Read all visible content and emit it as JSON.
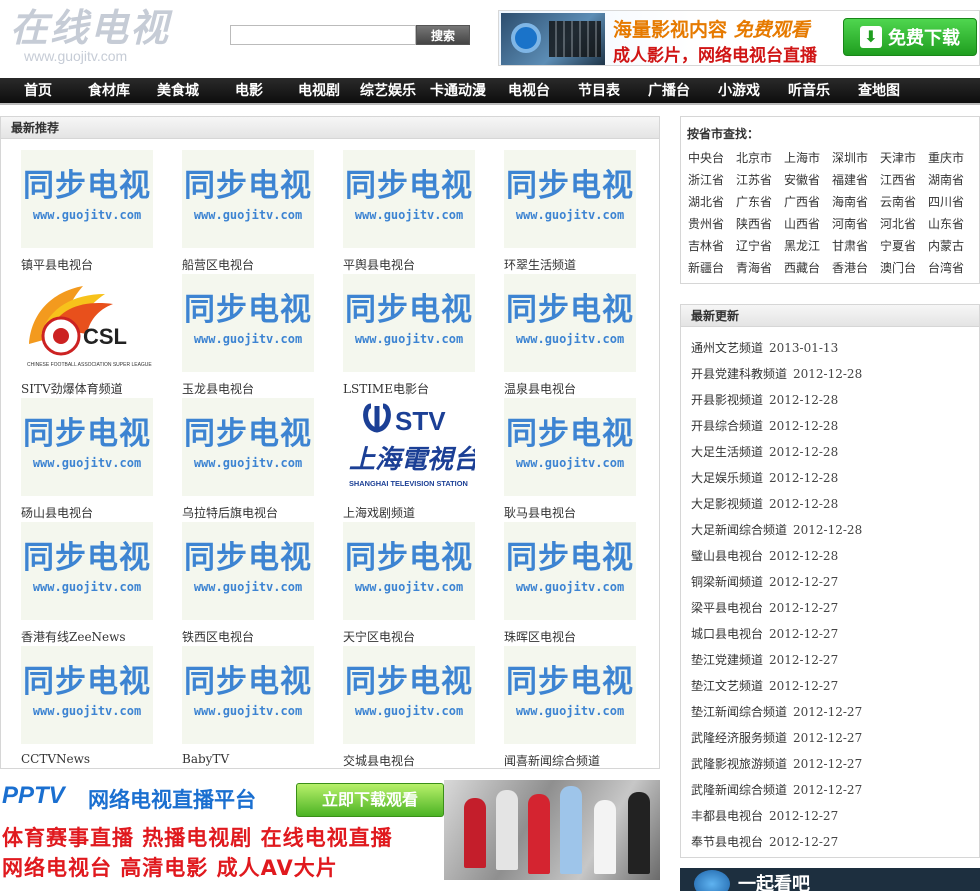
{
  "header": {
    "logo_text": "在线电视",
    "logo_url": "www.guojitv.com",
    "search_placeholder": "",
    "search_button": "搜索"
  },
  "ad_top": {
    "line1_a": "海量影视内容",
    "line1_b": "免费观看",
    "line2": "成人影片，网络电视台直播",
    "download": "免费下载"
  },
  "nav": [
    "首页",
    "食材库",
    "美食城",
    "电影",
    "电视剧",
    "综艺娱乐",
    "卡通动漫",
    "电视台",
    "节目表",
    "广播台",
    "小游戏",
    "听音乐",
    "查地图"
  ],
  "recommend": {
    "title": "最新推荐",
    "placeholder_big": "同步电视",
    "placeholder_small": "www.guojitv.com",
    "items": [
      {
        "name": "镇平县电视台",
        "thumb": "placeholder"
      },
      {
        "name": "船营区电视台",
        "thumb": "placeholder"
      },
      {
        "name": "平舆县电视台",
        "thumb": "placeholder"
      },
      {
        "name": "环翠生活频道",
        "thumb": "placeholder"
      },
      {
        "name": "SITV劲爆体育频道",
        "thumb": "csl"
      },
      {
        "name": "玉龙县电视台",
        "thumb": "placeholder"
      },
      {
        "name": "LSTIME电影台",
        "thumb": "placeholder"
      },
      {
        "name": "温泉县电视台",
        "thumb": "placeholder"
      },
      {
        "name": "砀山县电视台",
        "thumb": "placeholder"
      },
      {
        "name": "乌拉特后旗电视台",
        "thumb": "placeholder"
      },
      {
        "name": "上海戏剧频道",
        "thumb": "stv"
      },
      {
        "name": "耿马县电视台",
        "thumb": "placeholder"
      },
      {
        "name": "香港有线ZeeNews",
        "thumb": "placeholder"
      },
      {
        "name": "铁西区电视台",
        "thumb": "placeholder"
      },
      {
        "name": "天宁区电视台",
        "thumb": "placeholder"
      },
      {
        "name": "珠晖区电视台",
        "thumb": "placeholder"
      },
      {
        "name": "CCTVNews",
        "thumb": "placeholder"
      },
      {
        "name": "BabyTV",
        "thumb": "placeholder"
      },
      {
        "name": "交城县电视台",
        "thumb": "placeholder"
      },
      {
        "name": "闻喜新闻综合频道",
        "thumb": "placeholder"
      }
    ]
  },
  "csl": {
    "text": "CSL",
    "subtext": "CHINESE FOOTBALL ASSOCIATION SUPER LEAGUE"
  },
  "stv": {
    "brand": "STV",
    "cn": "上海電視台",
    "en": "SHANGHAI TELEVISION STATION"
  },
  "banner": {
    "brand": "PPTV",
    "slogan": "网络电视直播平台",
    "button": "立即下载观看",
    "row1": "体育赛事直播  热播电视剧  在线电视直播",
    "row2": "网络电视台  高清电影  成人AV大片"
  },
  "provinces": {
    "title": "按省市查找：",
    "items": [
      "中央台",
      "北京市",
      "上海市",
      "深圳市",
      "天津市",
      "重庆市",
      "浙江省",
      "江苏省",
      "安徽省",
      "福建省",
      "江西省",
      "湖南省",
      "湖北省",
      "广东省",
      "广西省",
      "海南省",
      "云南省",
      "四川省",
      "贵州省",
      "陕西省",
      "山西省",
      "河南省",
      "河北省",
      "山东省",
      "吉林省",
      "辽宁省",
      "黑龙江",
      "甘肃省",
      "宁夏省",
      "内蒙古",
      "新疆台",
      "青海省",
      "西藏台",
      "香港台",
      "澳门台",
      "台湾省"
    ]
  },
  "updates": {
    "title": "最新更新",
    "items": [
      {
        "name": "通州文艺频道",
        "date": "2013-01-13"
      },
      {
        "name": "开县党建科教频道",
        "date": "2012-12-28"
      },
      {
        "name": "开县影视频道",
        "date": "2012-12-28"
      },
      {
        "name": "开县综合频道",
        "date": "2012-12-28"
      },
      {
        "name": "大足生活频道",
        "date": "2012-12-28"
      },
      {
        "name": "大足娱乐频道",
        "date": "2012-12-28"
      },
      {
        "name": "大足影视频道",
        "date": "2012-12-28"
      },
      {
        "name": "大足新闻综合频道",
        "date": "2012-12-28"
      },
      {
        "name": "璧山县电视台",
        "date": "2012-12-28"
      },
      {
        "name": "铜梁新闻频道",
        "date": "2012-12-27"
      },
      {
        "name": "梁平县电视台",
        "date": "2012-12-27"
      },
      {
        "name": "城口县电视台",
        "date": "2012-12-27"
      },
      {
        "name": "垫江党建频道",
        "date": "2012-12-27"
      },
      {
        "name": "垫江文艺频道",
        "date": "2012-12-27"
      },
      {
        "name": "垫江新闻综合频道",
        "date": "2012-12-27"
      },
      {
        "name": "武隆经济服务频道",
        "date": "2012-12-27"
      },
      {
        "name": "武隆影视旅游频道",
        "date": "2012-12-27"
      },
      {
        "name": "武隆新闻综合频道",
        "date": "2012-12-27"
      },
      {
        "name": "丰都县电视台",
        "date": "2012-12-27"
      },
      {
        "name": "奉节县电视台",
        "date": "2012-12-27"
      }
    ]
  },
  "together": {
    "title": "一起看吧"
  }
}
